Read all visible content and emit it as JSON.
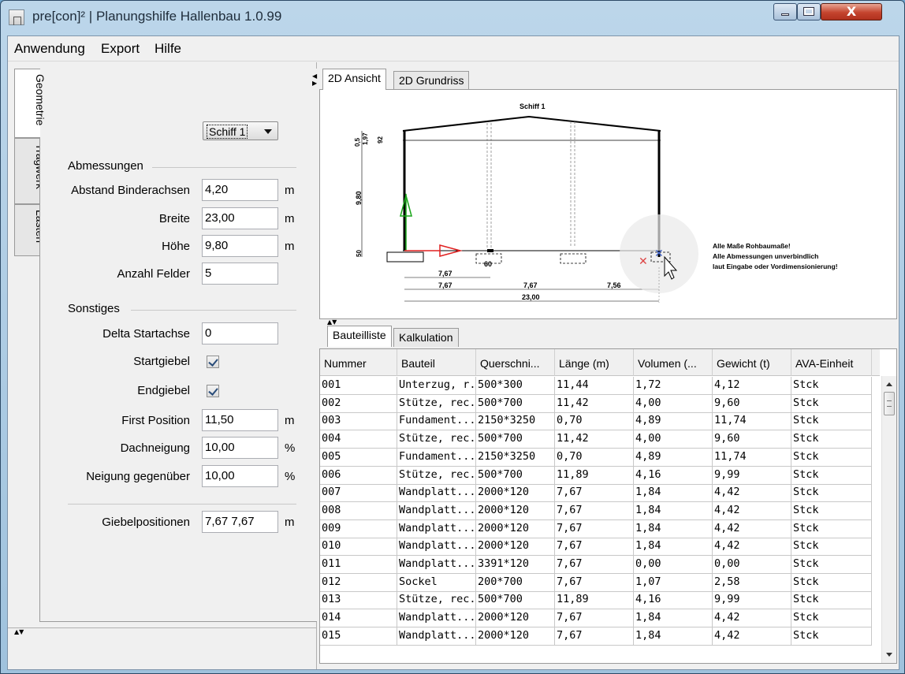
{
  "window": {
    "title": "pre[con]² | Planungshilfe Hallenbau 1.0.99",
    "close_symbol": "X"
  },
  "menu": [
    "Anwendung",
    "Export",
    "Hilfe"
  ],
  "left_tabs": [
    "Geometrie",
    "Tragwerk",
    "Lasten"
  ],
  "ship_select": {
    "value": "Schiff 1"
  },
  "sections": {
    "abmessungen": "Abmessungen",
    "sonstiges": "Sonstiges"
  },
  "fields": {
    "abstand": {
      "label": "Abstand Binderachsen",
      "value": "4,20",
      "unit": "m"
    },
    "breite": {
      "label": "Breite",
      "value": "23,00",
      "unit": "m"
    },
    "hoehe": {
      "label": "Höhe",
      "value": "9,80",
      "unit": "m"
    },
    "felder": {
      "label": "Anzahl Felder",
      "value": "5"
    },
    "delta": {
      "label": "Delta Startachse",
      "value": "0"
    },
    "startgiebel": {
      "label": "Startgiebel",
      "checked": true
    },
    "endgiebel": {
      "label": "Endgiebel",
      "checked": true
    },
    "first": {
      "label": "First Position",
      "value": "11,50",
      "unit": "m"
    },
    "dachneigung": {
      "label": "Dachneigung",
      "value": "10,00",
      "unit": "%"
    },
    "neigung": {
      "label": "Neigung gegenüber",
      "value": "10,00",
      "unit": "%"
    },
    "giebel": {
      "label": "Giebelpositionen",
      "value": "7,67 7,67",
      "unit": "m"
    }
  },
  "view_tabs": [
    "2D Ansicht",
    "2D Grundriss"
  ],
  "drawing": {
    "title": "Schiff 1",
    "dims_left": [
      "0,5",
      "1,97",
      "92",
      "9,80",
      "50"
    ],
    "dim_760": "7,67",
    "dims_row": [
      "7,67",
      "7,67",
      "7,56"
    ],
    "dim_total": "23,00",
    "foundation_label": "60",
    "notes": [
      "Alle Maße Rohbaumaße!",
      "Alle Abmessungen unverbindlich",
      "laut Eingabe oder Vordimensionierung!"
    ]
  },
  "list_tabs": [
    "Bauteilliste",
    "Kalkulation"
  ],
  "table": {
    "columns": [
      "Nummer",
      "Bauteil",
      "Querschni...",
      "Länge (m)",
      "Volumen (...",
      "Gewicht (t)",
      "AVA-Einheit"
    ],
    "rows": [
      [
        "001",
        "Unterzug, r...",
        "500*300",
        "11,44",
        "1,72",
        "4,12",
        "Stck"
      ],
      [
        "002",
        "Stütze, rec...",
        "500*700",
        "11,42",
        "4,00",
        "9,60",
        "Stck"
      ],
      [
        "003",
        "Fundament...",
        "2150*3250",
        "0,70",
        "4,89",
        "11,74",
        "Stck"
      ],
      [
        "004",
        "Stütze, rec...",
        "500*700",
        "11,42",
        "4,00",
        "9,60",
        "Stck"
      ],
      [
        "005",
        "Fundament...",
        "2150*3250",
        "0,70",
        "4,89",
        "11,74",
        "Stck"
      ],
      [
        "006",
        "Stütze, rec...",
        "500*700",
        "11,89",
        "4,16",
        "9,99",
        "Stck"
      ],
      [
        "007",
        "Wandplatt...",
        "2000*120",
        "7,67",
        "1,84",
        "4,42",
        "Stck"
      ],
      [
        "008",
        "Wandplatt...",
        "2000*120",
        "7,67",
        "1,84",
        "4,42",
        "Stck"
      ],
      [
        "009",
        "Wandplatt...",
        "2000*120",
        "7,67",
        "1,84",
        "4,42",
        "Stck"
      ],
      [
        "010",
        "Wandplatt...",
        "2000*120",
        "7,67",
        "1,84",
        "4,42",
        "Stck"
      ],
      [
        "011",
        "Wandplatt...",
        "3391*120",
        "7,67",
        "0,00",
        "0,00",
        "Stck"
      ],
      [
        "012",
        "Sockel",
        "200*700",
        "7,67",
        "1,07",
        "2,58",
        "Stck"
      ],
      [
        "013",
        "Stütze, rec...",
        "500*700",
        "11,89",
        "4,16",
        "9,99",
        "Stck"
      ],
      [
        "014",
        "Wandplatt...",
        "2000*120",
        "7,67",
        "1,84",
        "4,42",
        "Stck"
      ],
      [
        "015",
        "Wandplatt...",
        "2000*120",
        "7,67",
        "1,84",
        "4,42",
        "Stck"
      ]
    ]
  },
  "colors": {
    "accent_green": "#1aa51a",
    "accent_red": "#e02020",
    "title_blue": "#9fc2dd"
  }
}
